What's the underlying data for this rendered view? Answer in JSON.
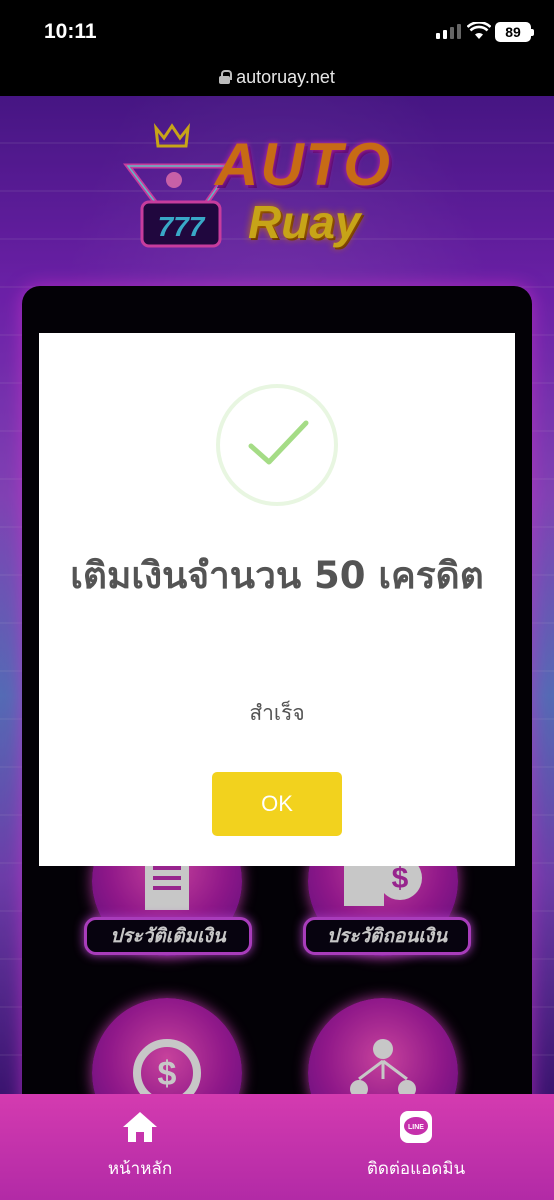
{
  "status_bar": {
    "time": "10:11",
    "battery": "89"
  },
  "browser": {
    "url": "autoruay.net"
  },
  "logo": {
    "line1": "AUTO",
    "line2": "Ruay",
    "slot_digits": "777"
  },
  "menu": {
    "items": [
      {
        "label": "ประวัติเติมเงิน",
        "icon": "document-icon"
      },
      {
        "label": "ประวัติถอนเงิน",
        "icon": "money-document-icon"
      },
      {
        "label": "",
        "icon": "refresh-dollar-icon"
      },
      {
        "label": "",
        "icon": "network-people-icon"
      }
    ]
  },
  "modal": {
    "title": "เติมเงินจำนวน 50 เครดิต",
    "text": "สำเร็จ",
    "ok_label": "OK",
    "icon": "checkmark-icon"
  },
  "bottom_nav": {
    "home_label": "หน้าหลัก",
    "contact_label": "ติดต่อแอดมิน",
    "line_badge": "LINE"
  },
  "colors": {
    "ok_button": "#f2d21e",
    "success_check": "#a5dc86",
    "nav_background": "#c530ab"
  }
}
